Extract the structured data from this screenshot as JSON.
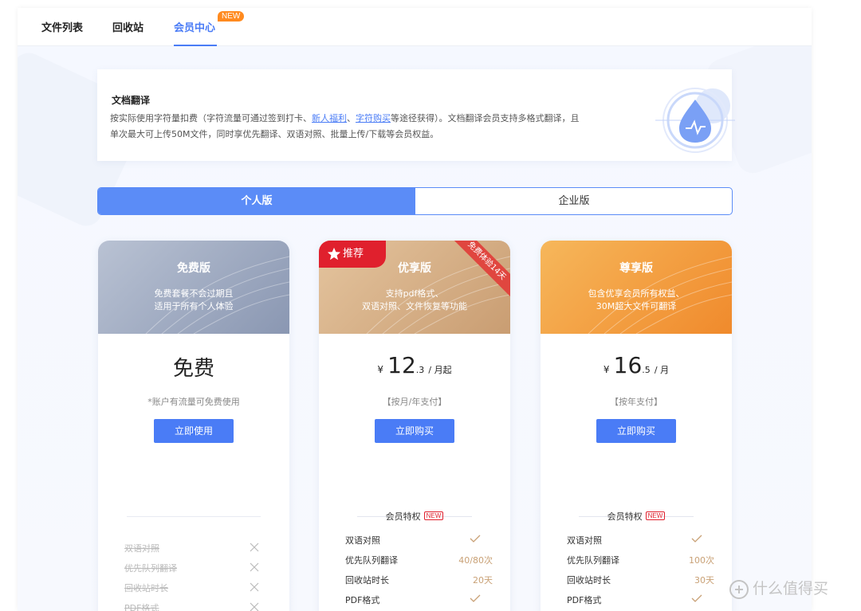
{
  "nav": {
    "tabs": [
      {
        "label": "文件列表"
      },
      {
        "label": "回收站"
      },
      {
        "label": "会员中心"
      }
    ],
    "new_badge": "NEW"
  },
  "intro": {
    "title": "文档翻译",
    "desc_1": "按实际使用字符量扣费（字符流量可通过签到打卡、",
    "link_1": "新人福利",
    "desc_sep": "、",
    "link_2": "字符购买",
    "desc_2": "等途径获得）。文档翻译会员支持多格式翻译，且单次最大可上传50M文件，同时享优先翻译、双语对照、批量上传/下载等会员权益。"
  },
  "segment": {
    "personal": "个人版",
    "enterprise": "企业版"
  },
  "plans": {
    "free": {
      "name": "免费版",
      "sub_1": "免费套餐不会过期且",
      "sub_2": "适用于所有个人体验",
      "price": "免费",
      "note": "*账户有流量可免费使用",
      "cta": "立即使用",
      "perks": [
        {
          "label": "双语对照"
        },
        {
          "label": "优先队列翻译"
        },
        {
          "label": "回收站时长"
        },
        {
          "label": "PDF格式"
        }
      ]
    },
    "plus": {
      "badge": "推荐",
      "ribbon": "免费体验14天",
      "name": "优享版",
      "sub_1": "支持pdf格式、",
      "sub_2": "双语对照、文件恢复等功能",
      "currency": "¥",
      "price_int": "12",
      "price_dec": ".3",
      "unit": "/ 月起",
      "note": "【按月/年支付】",
      "cta": "立即购买",
      "perk_title": "会员特权",
      "perk_new": "NEW",
      "perks": [
        {
          "label": "双语对照",
          "value": ""
        },
        {
          "label": "优先队列翻译",
          "value": "40/80次"
        },
        {
          "label": "回收站时长",
          "value": "20天"
        },
        {
          "label": "PDF格式",
          "value": ""
        }
      ]
    },
    "vip": {
      "name": "尊享版",
      "sub_1": "包含优享会员所有权益、",
      "sub_2": "30M超大文件可翻译",
      "currency": "¥",
      "price_int": "16",
      "price_dec": ".5",
      "unit": "/ 月",
      "note": "【按年支付】",
      "cta": "立即购买",
      "perk_title": "会员特权",
      "perk_new": "NEW",
      "perks": [
        {
          "label": "双语对照",
          "value": ""
        },
        {
          "label": "优先队列翻译",
          "value": "100次"
        },
        {
          "label": "回收站时长",
          "value": "30天"
        },
        {
          "label": "PDF格式",
          "value": ""
        }
      ]
    }
  },
  "watermark": "什么值得买",
  "colors": {
    "accent": "#4a7cf6",
    "gold": "#c9a176",
    "red": "#e0202d",
    "orange": "#f08a2c"
  }
}
